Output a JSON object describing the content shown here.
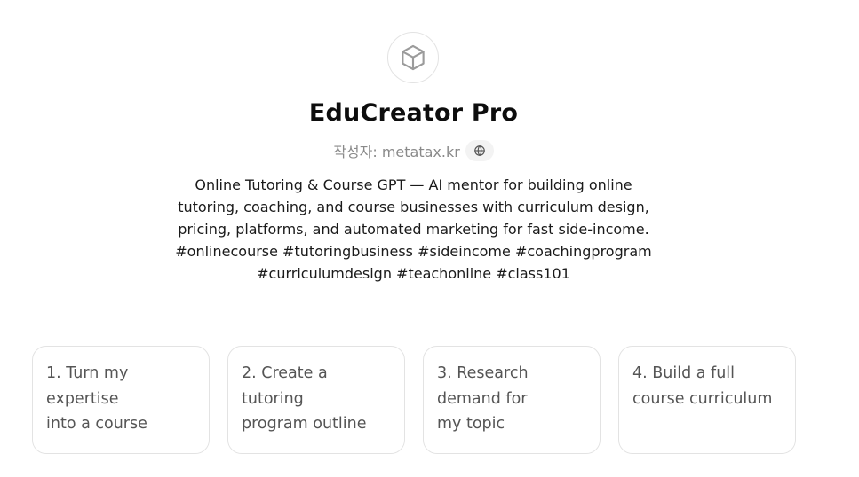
{
  "gpt": {
    "icon": "cube-icon",
    "title": "EduCreator Pro",
    "author_label": "작성자: metatax.kr",
    "website_icon": "globe-icon",
    "description": "Online Tutoring & Course GPT — AI mentor for building online tutoring, coaching, and course businesses with curriculum design, pricing, platforms, and automated marketing for fast side-income. #onlinecourse #tutoringbusiness #sideincome #coachingprogram #curriculumdesign #teachonline #class101"
  },
  "starters": [
    {
      "label": "1. Turn my\nexpertise\ninto a course"
    },
    {
      "label": "2. Create a tutoring\nprogram outline"
    },
    {
      "label": "3. Research\ndemand for\nmy topic"
    },
    {
      "label": "4. Build a full\ncourse curriculum"
    }
  ],
  "colors": {
    "border": "#e3e3e3",
    "muted_text": "#8a8a8a",
    "card_text": "#555555",
    "title_text": "#0d0d0d"
  }
}
